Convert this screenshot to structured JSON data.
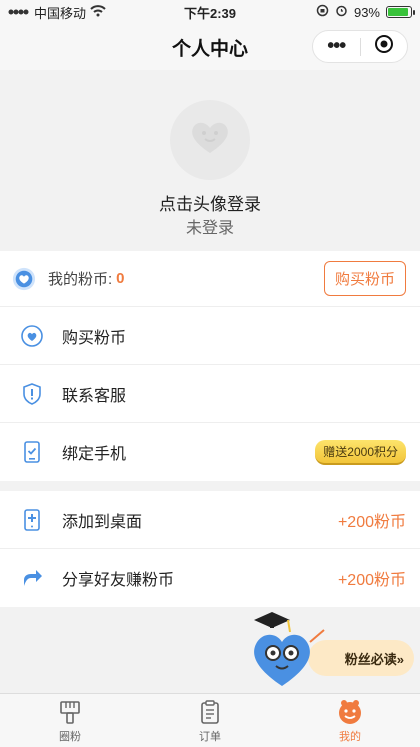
{
  "status_bar": {
    "carrier": "中国移动",
    "time": "下午2:39",
    "battery_percent": "93%",
    "battery_level": 0.93
  },
  "nav": {
    "title": "个人中心",
    "more_label": "•••"
  },
  "profile": {
    "login_prompt": "点击头像登录",
    "login_status": "未登录"
  },
  "coins": {
    "label": "我的粉币:",
    "value": "0",
    "buy_button": "购买粉币"
  },
  "menu": [
    {
      "label": "购买粉币",
      "icon": "heart-shield-icon"
    },
    {
      "label": "联系客服",
      "icon": "shield-alert-icon"
    },
    {
      "label": "绑定手机",
      "icon": "phone-check-icon",
      "tag": "赠送2000积分"
    }
  ],
  "rewards": [
    {
      "label": "添加到桌面",
      "icon": "add-phone-icon",
      "reward": "+200粉币"
    },
    {
      "label": "分享好友赚粉币",
      "icon": "share-icon",
      "reward": "+200粉币"
    }
  ],
  "mascot": {
    "banner": "粉丝必读»"
  },
  "tabbar": [
    {
      "label": "圈粉",
      "icon": "brush-icon",
      "active": false
    },
    {
      "label": "订单",
      "icon": "clipboard-icon",
      "active": false
    },
    {
      "label": "我的",
      "icon": "smiley-icon",
      "active": true
    }
  ],
  "colors": {
    "accent": "#f07b3f",
    "icon_blue": "#4a90e2",
    "battery_green": "#38c23a"
  }
}
